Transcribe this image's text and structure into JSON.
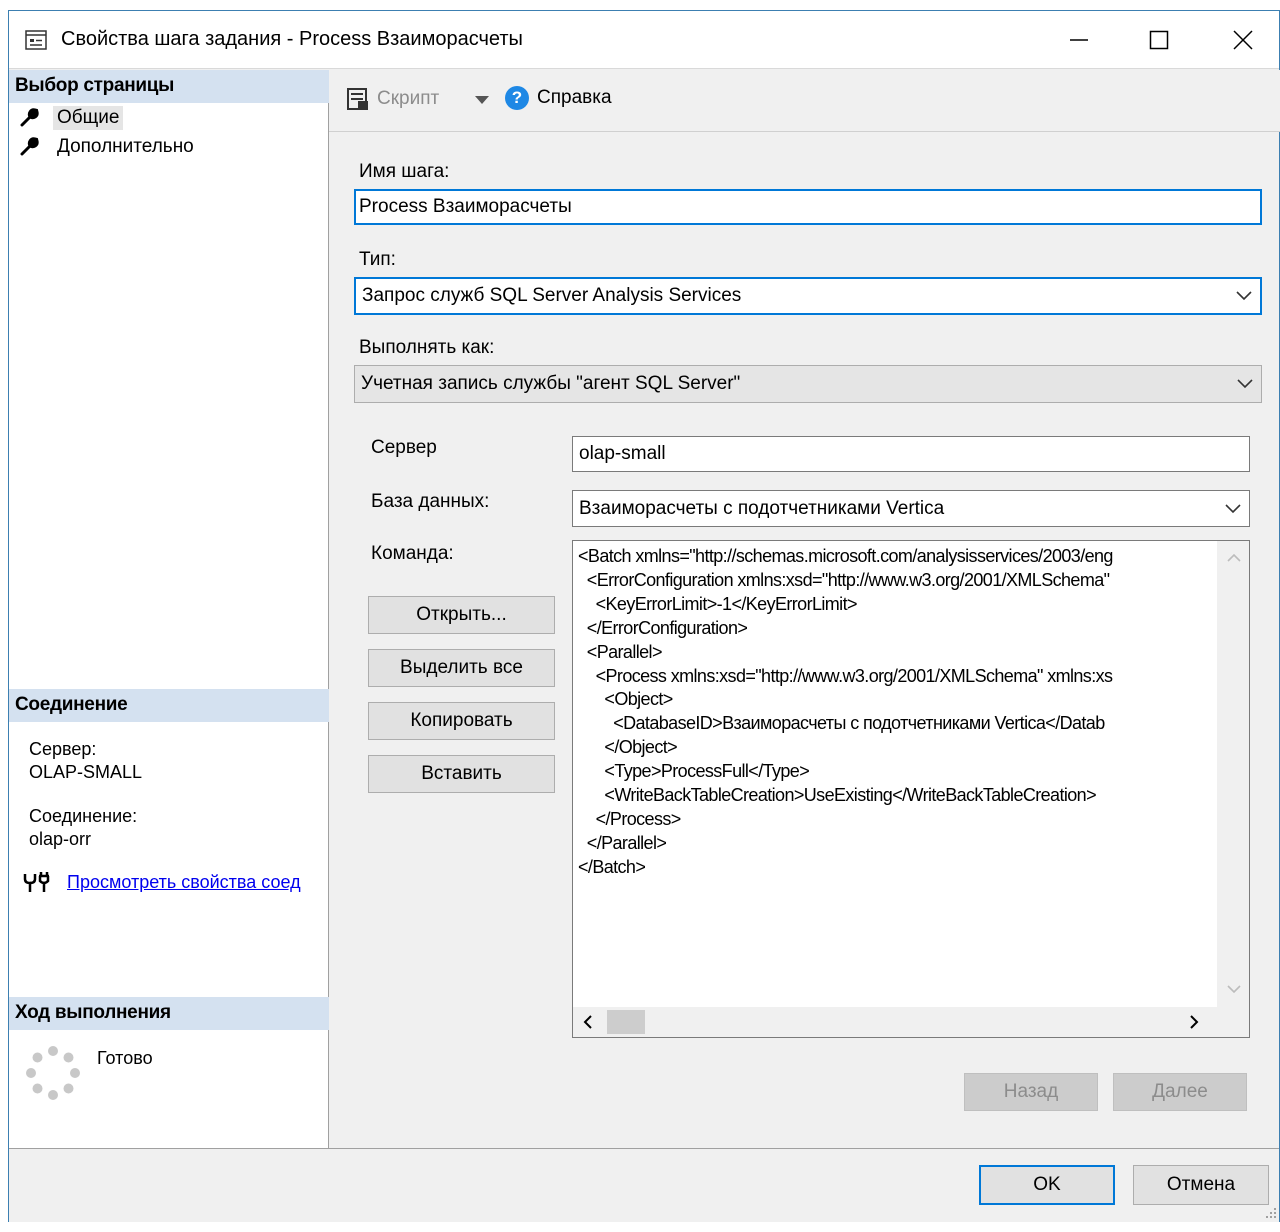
{
  "window": {
    "title": "Свойства шага задания - Process Взаиморасчеты"
  },
  "sidebar": {
    "select_page_header": "Выбор страницы",
    "pages": [
      {
        "label": "Общие"
      },
      {
        "label": "Дополнительно"
      }
    ],
    "connection_header": "Соединение",
    "server_label": "Сервер:",
    "server_value": "OLAP-SMALL",
    "connection_label": "Соединение:",
    "connection_value": "olap-orr",
    "view_connection_link": "Просмотреть свойства соед",
    "progress_header": "Ход выполнения",
    "progress_status": "Готово"
  },
  "toolbar": {
    "script_label": "Скрипт",
    "help_label": "Справка"
  },
  "form": {
    "step_name_label": "Имя шага:",
    "step_name_value": "Process Взаиморасчеты",
    "type_label": "Тип:",
    "type_value": "Запрос служб SQL Server Analysis Services",
    "run_as_label": "Выполнять как:",
    "run_as_value": "Учетная запись службы \"агент SQL Server\"",
    "server_label": "Сервер",
    "server_value": "olap-small",
    "database_label": "База данных:",
    "database_value": "Взаиморасчеты с подотчетниками Vertica",
    "command_label": "Команда:",
    "command_lines": [
      "<Batch xmlns=\"http://schemas.microsoft.com/analysisservices/2003/eng",
      "  <ErrorConfiguration xmlns:xsd=\"http://www.w3.org/2001/XMLSchema\"",
      "    <KeyErrorLimit>-1</KeyErrorLimit>",
      "  </ErrorConfiguration>",
      "  <Parallel>",
      "    <Process xmlns:xsd=\"http://www.w3.org/2001/XMLSchema\" xmlns:xs",
      "      <Object>",
      "        <DatabaseID>Взаиморасчеты с подотчетниками Vertica</Datab",
      "      </Object>",
      "      <Type>ProcessFull</Type>",
      "      <WriteBackTableCreation>UseExisting</WriteBackTableCreation>",
      "    </Process>",
      "  </Parallel>",
      "</Batch>"
    ],
    "open_button": "Открыть...",
    "select_all_button": "Выделить все",
    "copy_button": "Копировать",
    "paste_button": "Вставить",
    "back_button": "Назад",
    "next_button": "Далее"
  },
  "footer": {
    "ok_button": "OK",
    "cancel_button": "Отмена"
  }
}
